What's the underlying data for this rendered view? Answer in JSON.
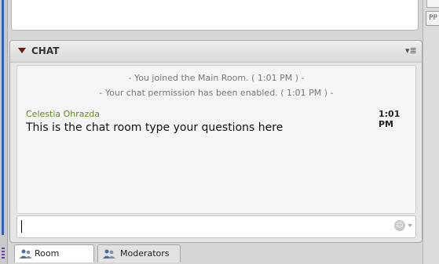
{
  "chat": {
    "title": "CHAT",
    "menu_glyph": "▾≣",
    "system_messages": [
      "- You joined the Main Room. ( 1:01 PM ) -",
      "- Your chat permission has been enabled. ( 1:01 PM ) -"
    ],
    "message": {
      "sender": "Celestia Ohrazda",
      "time": "1:01 PM",
      "text": "This is the chat room type your questions here"
    },
    "input": {
      "value": "",
      "placeholder": ""
    },
    "emoji_glyph": "☺"
  },
  "tabs": [
    {
      "label": "Room",
      "active": true
    },
    {
      "label": "Moderators",
      "active": false
    }
  ],
  "right_rail": {
    "button_glyph": "PP"
  },
  "colors": {
    "sender": "#5d8a1e",
    "accent": "#2d62b8",
    "header_triangle": "#7a1414"
  }
}
